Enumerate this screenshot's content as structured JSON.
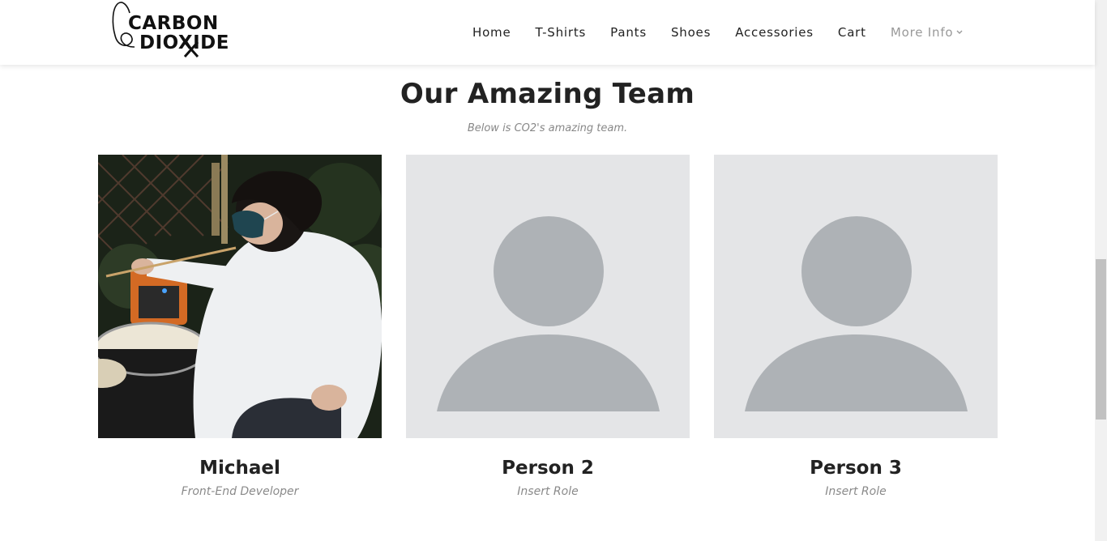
{
  "brand": {
    "line1": "CARBON",
    "line2": "DIOXIDE"
  },
  "nav": {
    "items": [
      "Home",
      "T-Shirts",
      "Pants",
      "Shoes",
      "Accessories",
      "Cart"
    ],
    "more": "More Info"
  },
  "section": {
    "title": "Our Amazing Team",
    "subtitle": "Below is CO2's amazing team."
  },
  "team": [
    {
      "name": "Michael",
      "role": "Front-End Developer"
    },
    {
      "name": "Person 2",
      "role": "Insert Role"
    },
    {
      "name": "Person 3",
      "role": "Insert Role"
    }
  ],
  "colors": {
    "placeholder_bg": "#e4e5e7",
    "placeholder_fg": "#aeb2b6",
    "accent_text": "#222222",
    "muted_text": "#8a8a8a"
  }
}
